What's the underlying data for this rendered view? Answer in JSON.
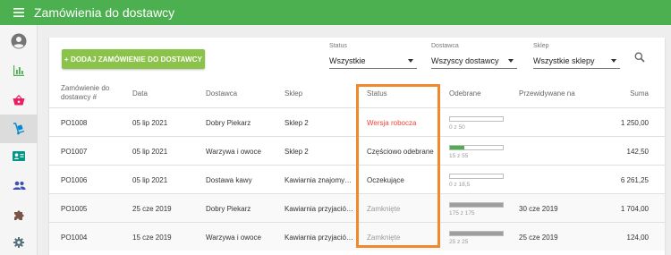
{
  "app": {
    "title": "Zamówienia do dostawcy",
    "accent": "#4caf50",
    "menu_icon": "menu-icon"
  },
  "sidebar": {
    "items": [
      {
        "name": "account",
        "icon": "account-icon",
        "active": false
      },
      {
        "name": "reports",
        "icon": "bar-chart-icon",
        "active": false
      },
      {
        "name": "sales",
        "icon": "basket-icon",
        "active": false
      },
      {
        "name": "purchases",
        "icon": "dolly-icon",
        "active": true
      },
      {
        "name": "customers",
        "icon": "contact-card-icon",
        "active": false
      },
      {
        "name": "employees",
        "icon": "people-icon",
        "active": false
      },
      {
        "name": "addons",
        "icon": "puzzle-icon",
        "active": false
      },
      {
        "name": "settings",
        "icon": "gear-icon",
        "active": false
      }
    ]
  },
  "toolbar": {
    "add_button": "+ DODAJ ZAMÓWIENIE DO DOSTAWCY",
    "filters": [
      {
        "label": "Status",
        "value": "Wszystkie"
      },
      {
        "label": "Dostawca",
        "value": "Wszyscy dostawcy"
      },
      {
        "label": "Sklep",
        "value": "Wszystkie sklepy"
      }
    ],
    "search_icon": "search-icon"
  },
  "table": {
    "headers": {
      "order_line1": "Zamówienie do",
      "order_line2": "dostawcy #",
      "date": "Data",
      "supplier": "Dostawca",
      "store": "Sklep",
      "status": "Status",
      "received": "Odebrane",
      "expected": "Przewidywane na",
      "total": "Suma"
    },
    "rows": [
      {
        "order": "PO1008",
        "date": "05 lip 2021",
        "supplier": "Dobry Piekarz",
        "store": "Sklep 2",
        "status": "Wersja robocza",
        "status_type": "draft",
        "received": "0 z 50",
        "received_fraction": 0,
        "expected": "",
        "total": "1 250,00"
      },
      {
        "order": "PO1007",
        "date": "05 lip 2021",
        "supplier": "Warzywa i owoce",
        "store": "Sklep 2",
        "status": "Częściowo odebrane",
        "status_type": "partial",
        "received": "15 z 55",
        "received_fraction": 0.273,
        "expected": "",
        "total": "142,50"
      },
      {
        "order": "PO1006",
        "date": "05 lip 2021",
        "supplier": "Dostawa kawy",
        "store": "Kawiarnia znajomy…",
        "status": "Oczekujące",
        "status_type": "pending",
        "received": "0 z 18,5",
        "received_fraction": 0,
        "expected": "",
        "total": "6 261,25"
      },
      {
        "order": "PO1005",
        "date": "25 cze 2019",
        "supplier": "Dobry Piekarz",
        "store": "Kawiarnia przyjació…",
        "status": "Zamknięte",
        "status_type": "closed",
        "received": "175 z 175",
        "received_fraction": 1,
        "expected": "30 cze 2019",
        "total": "1 704,00"
      },
      {
        "order": "PO1004",
        "date": "15 cze 2019",
        "supplier": "Warzywa i owoce",
        "store": "Kawiarnia przyjació…",
        "status": "Zamknięte",
        "status_type": "closed",
        "received": "25 z 25",
        "received_fraction": 1,
        "expected": "25 cze 2019",
        "total": "124,00"
      }
    ],
    "colors": {
      "draft": "#f44336",
      "partial_bar": "#4caf50",
      "closed_bar": "#9e9e9e",
      "highlight": "#f0892d"
    }
  }
}
